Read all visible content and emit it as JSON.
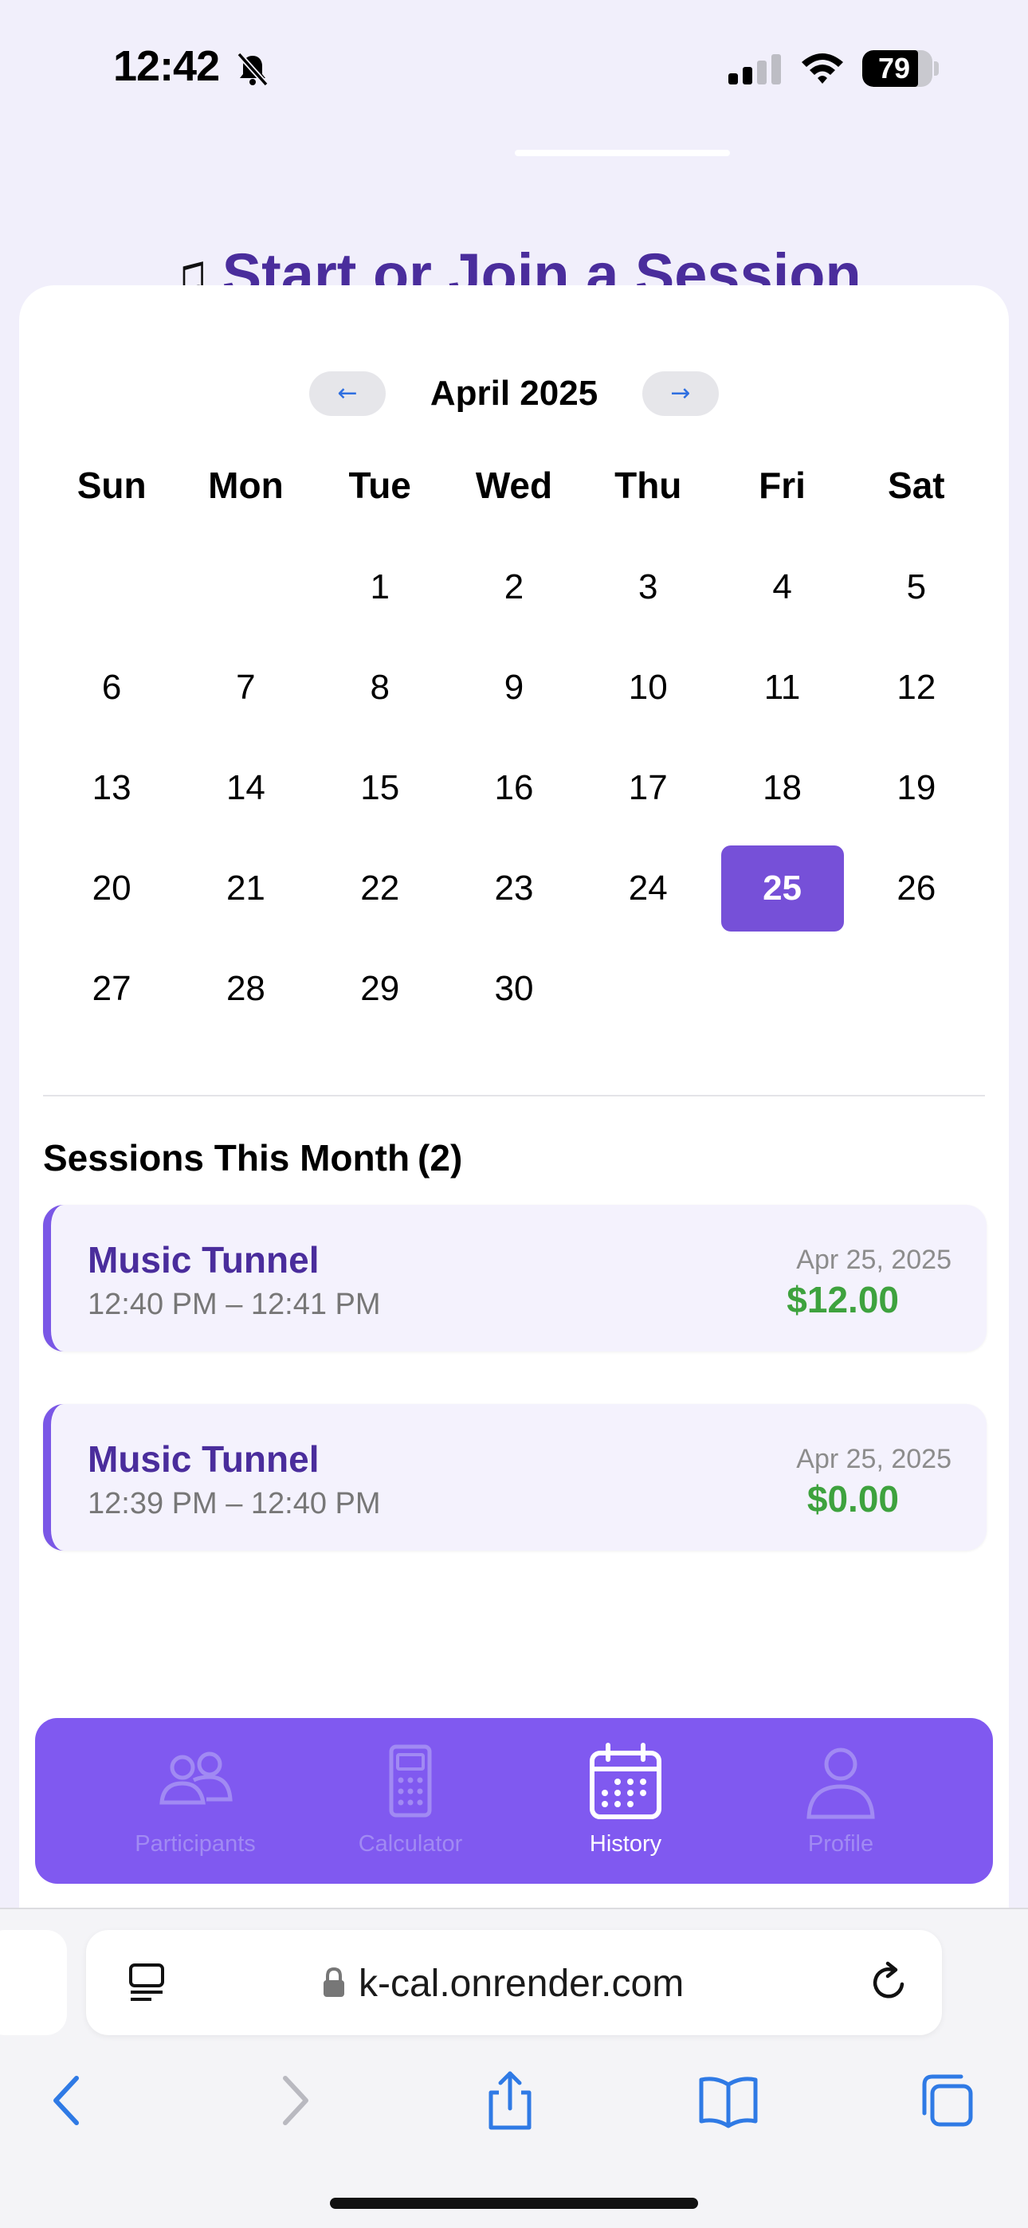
{
  "status_bar": {
    "time": "12:42",
    "battery_level": "79",
    "battery_fraction": 0.79
  },
  "page": {
    "heading": "Start or Join a Session"
  },
  "calendar": {
    "month_label": "April 2025",
    "prev_label": "←",
    "next_label": "→",
    "weekdays": [
      "Sun",
      "Mon",
      "Tue",
      "Wed",
      "Thu",
      "Fri",
      "Sat"
    ],
    "leading_blank_days": 2,
    "days": [
      "1",
      "2",
      "3",
      "4",
      "5",
      "6",
      "7",
      "8",
      "9",
      "10",
      "11",
      "12",
      "13",
      "14",
      "15",
      "16",
      "17",
      "18",
      "19",
      "20",
      "21",
      "22",
      "23",
      "24",
      "25",
      "26",
      "27",
      "28",
      "29",
      "30"
    ],
    "selected_day": "25",
    "accent_color": "#7650d8"
  },
  "sessions": {
    "title": "Sessions This Month",
    "count_label": "(2)",
    "items": [
      {
        "name": "Music Tunnel",
        "time_range": "12:40 PM – 12:41 PM",
        "date": "Apr 25, 2025",
        "amount": "$12.00"
      },
      {
        "name": "Music Tunnel",
        "time_range": "12:39 PM – 12:40 PM",
        "date": "Apr 25, 2025",
        "amount": "$0.00"
      }
    ]
  },
  "tabbar": {
    "tabs": [
      {
        "label": "Participants",
        "icon": "participants-icon"
      },
      {
        "label": "Calculator",
        "icon": "calculator-icon"
      },
      {
        "label": "History",
        "icon": "calendar-icon",
        "active": true
      },
      {
        "label": "Profile",
        "icon": "profile-icon"
      }
    ],
    "color": "#8059f0"
  },
  "browser": {
    "url": "k-cal.onrender.com"
  }
}
